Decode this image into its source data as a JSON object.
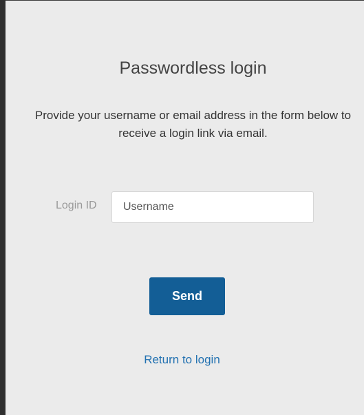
{
  "page": {
    "title": "Passwordless login",
    "description": "Provide your username or email address in the form below to receive a login link via email."
  },
  "form": {
    "login_label": "Login ID",
    "login_placeholder": "Username",
    "login_value": "",
    "send_label": "Send"
  },
  "links": {
    "return_to_login": "Return to login"
  },
  "colors": {
    "background": "#ebebeb",
    "button": "#135e96",
    "link": "#2271b1"
  }
}
